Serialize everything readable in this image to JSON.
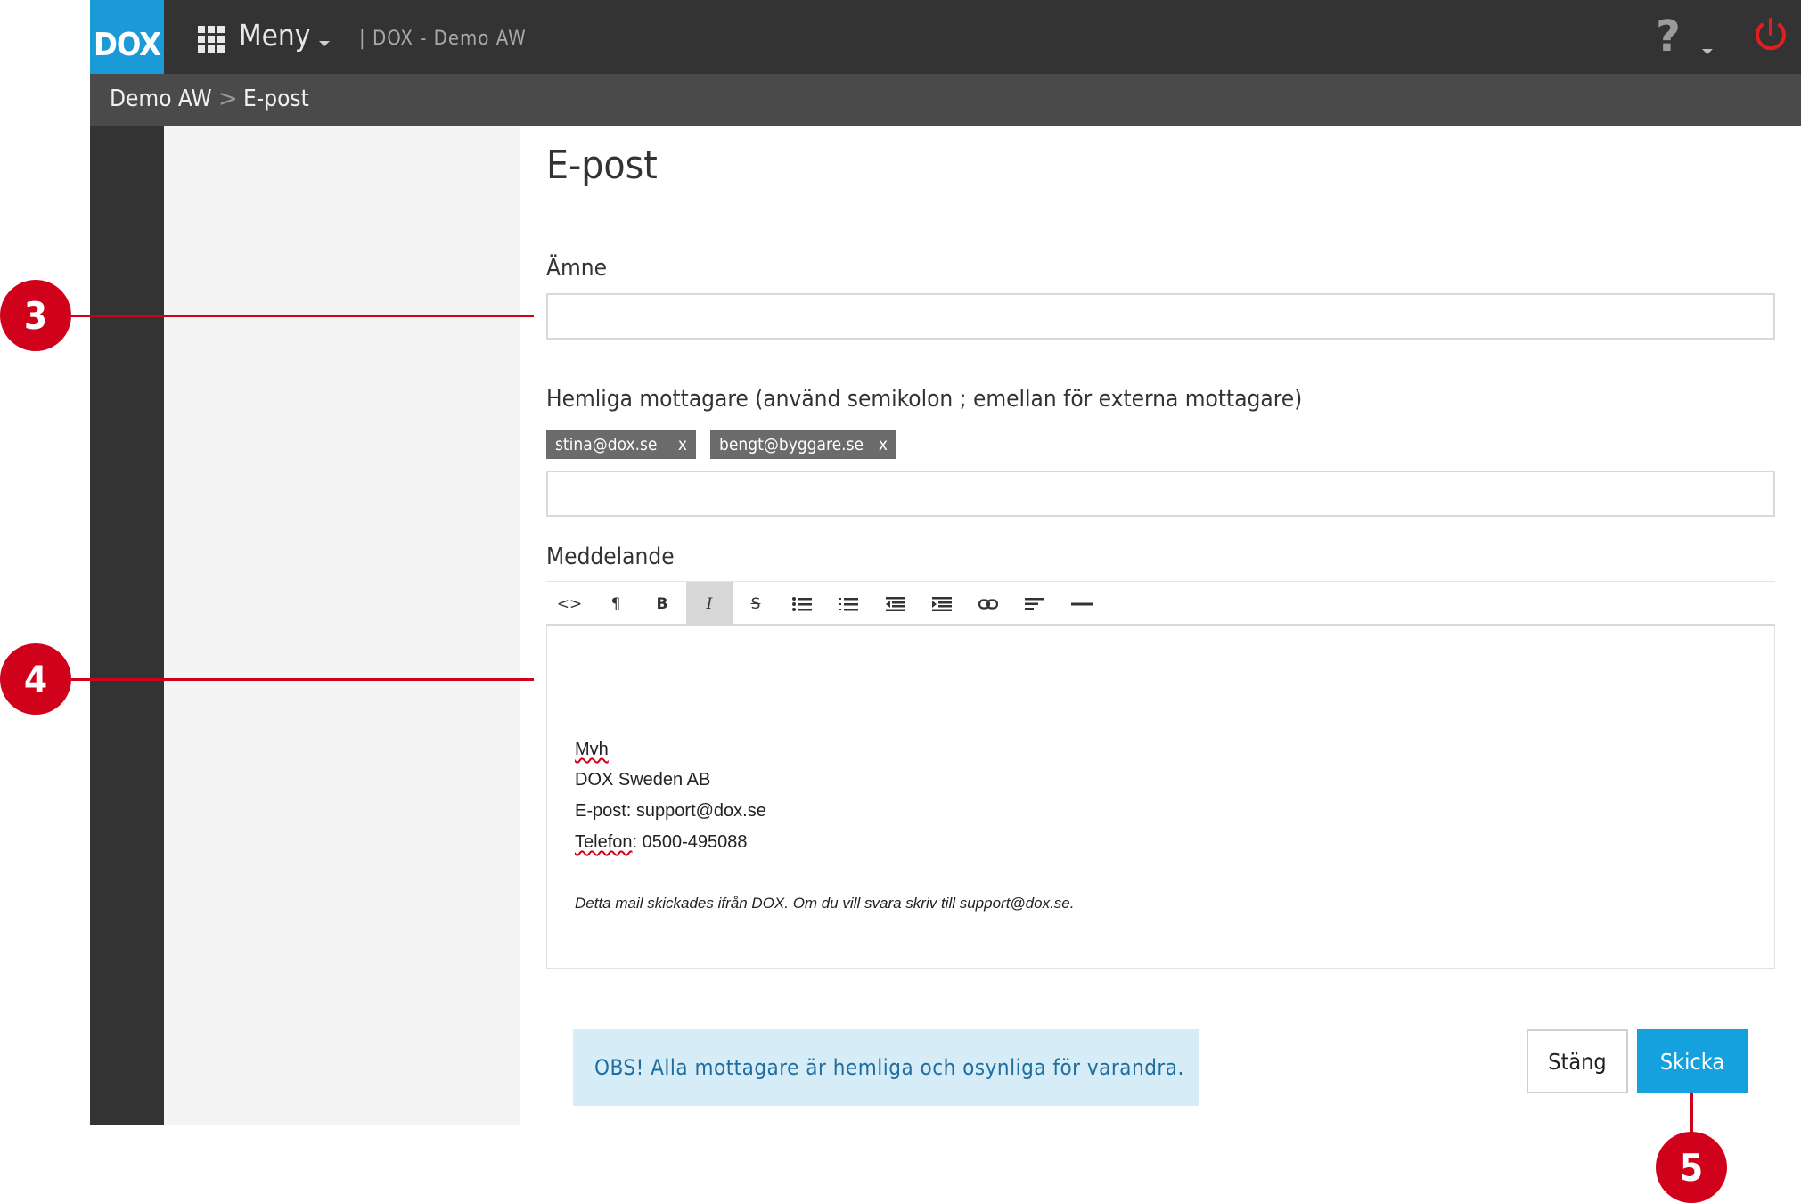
{
  "header": {
    "logo": "DOX",
    "menu_label": "Meny",
    "app_title": "| DOX - Demo AW",
    "help_icon_glyph": "?",
    "icons": [
      "apps-grid-icon",
      "help-icon",
      "power-icon"
    ]
  },
  "breadcrumb": {
    "items": [
      "Demo AW",
      "E-post"
    ],
    "separator": ">"
  },
  "page": {
    "title": "E-post"
  },
  "form": {
    "subject_label": "Ämne",
    "subject_value": "",
    "bcc_label": "Hemliga mottagare (använd semikolon ; emellan för externa mottagare)",
    "bcc_tags": [
      {
        "email": "stina@dox.se",
        "remove": "x"
      },
      {
        "email": "bengt@byggare.se",
        "remove": "x"
      }
    ],
    "bcc_input_value": "",
    "message_label": "Meddelande"
  },
  "editor": {
    "toolbar": [
      {
        "name": "html-source",
        "glyph": "<>"
      },
      {
        "name": "paragraph",
        "glyph": "¶"
      },
      {
        "name": "bold",
        "glyph": "B"
      },
      {
        "name": "italic",
        "glyph": "I",
        "active": true
      },
      {
        "name": "strikethrough",
        "glyph": "S"
      },
      {
        "name": "unordered-list",
        "glyph": "list"
      },
      {
        "name": "ordered-list",
        "glyph": "olist"
      },
      {
        "name": "outdent",
        "glyph": "outdent"
      },
      {
        "name": "indent",
        "glyph": "indent"
      },
      {
        "name": "link",
        "glyph": "link"
      },
      {
        "name": "align",
        "glyph": "align"
      },
      {
        "name": "horizontal-rule",
        "glyph": "hr"
      }
    ],
    "signature": {
      "greeting": "Mvh",
      "company": "DOX Sweden AB",
      "email_line": "E-post: support@dox.se",
      "phone_label": "Telefon",
      "phone_value": ": 0500-495088"
    },
    "disclaimer": "Detta mail skickades ifrån DOX. Om du vill svara skriv till support@dox.se."
  },
  "footer": {
    "notice": "OBS! Alla mottagare är hemliga och osynliga för varandra.",
    "close_label": "Stäng",
    "send_label": "Skicka"
  },
  "callouts": [
    "3",
    "4",
    "5"
  ],
  "colors": {
    "brand_blue": "#1a9bd8",
    "send_button": "#15a1dd",
    "topbar": "#333333",
    "callout_red": "#d0021b",
    "notice_bg": "#d6ecf6"
  }
}
